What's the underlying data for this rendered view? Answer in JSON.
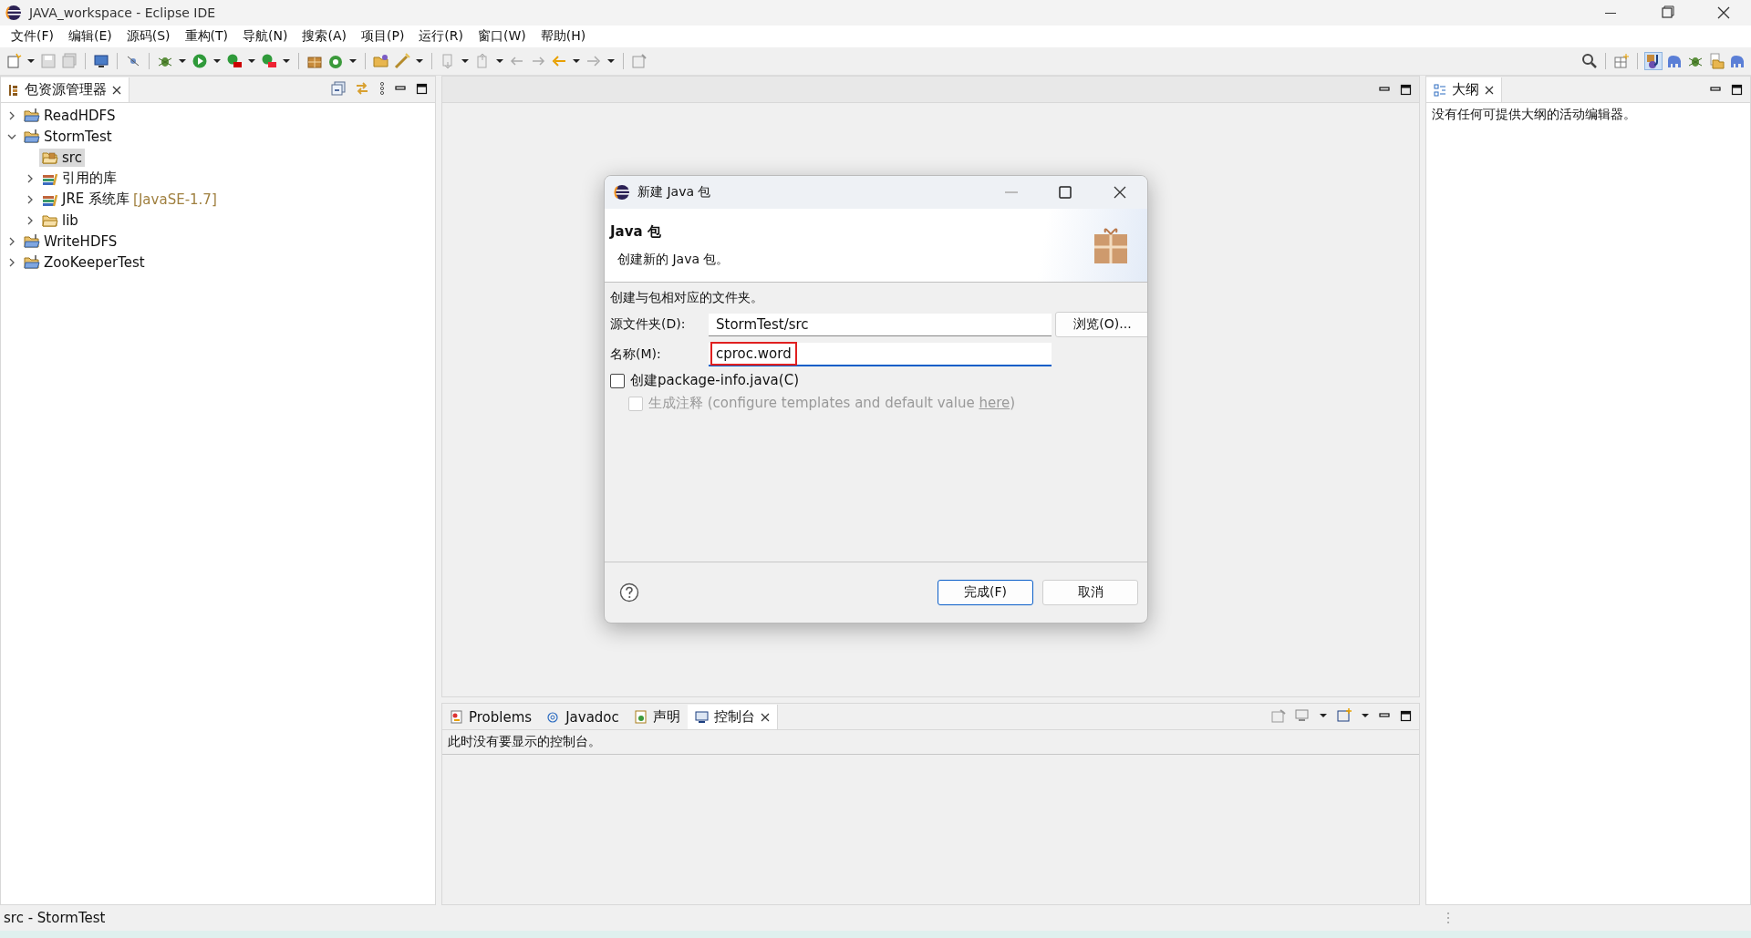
{
  "window": {
    "title": "JAVA_workspace - Eclipse IDE"
  },
  "menu": [
    "文件(F)",
    "编辑(E)",
    "源码(S)",
    "重构(T)",
    "导航(N)",
    "搜索(A)",
    "项目(P)",
    "运行(R)",
    "窗口(W)",
    "帮助(H)"
  ],
  "package_explorer": {
    "tab": "包资源管理器",
    "tree": [
      {
        "label": "ReadHDFS",
        "kind": "project",
        "expanded": false,
        "selected": false
      },
      {
        "label": "StormTest",
        "kind": "project",
        "expanded": true,
        "selected": false,
        "children": [
          {
            "label": "src",
            "kind": "source",
            "selected": true
          },
          {
            "label": "引用的库",
            "kind": "library",
            "expanded": false,
            "selected": false
          },
          {
            "label": "JRE 系统库",
            "decoration": "[JavaSE-1.7]",
            "kind": "library",
            "expanded": false,
            "selected": false
          },
          {
            "label": "lib",
            "kind": "folder",
            "expanded": false,
            "selected": false
          }
        ]
      },
      {
        "label": "WriteHDFS",
        "kind": "project",
        "expanded": false,
        "selected": false
      },
      {
        "label": "ZooKeeperTest",
        "kind": "project",
        "expanded": false,
        "selected": false
      }
    ]
  },
  "outline": {
    "tab": "大纲",
    "message": "没有任何可提供大纲的活动编辑器。"
  },
  "dialog": {
    "title": "新建 Java 包",
    "header": "Java 包",
    "description": "创建新的 Java 包。",
    "section": "创建与包相对应的文件夹。",
    "fields": [
      {
        "label": "源文件夹(D):",
        "value": "StormTest/src",
        "button": "浏览(O)...",
        "focused": false,
        "highlighted": false
      },
      {
        "label": "名称(M):",
        "value": "cproc.word",
        "focused": true,
        "highlighted": true
      }
    ],
    "checkboxes": [
      {
        "label": "创建package-info.java(C)",
        "checked": false,
        "disabled": false
      },
      {
        "label": "生成注释 (configure templates and default value ",
        "link": "here",
        "suffix": ")",
        "checked": false,
        "disabled": true
      }
    ],
    "buttons": [
      {
        "label": "完成(F)",
        "default": true
      },
      {
        "label": "取消",
        "default": false
      }
    ]
  },
  "bottom_panel": {
    "tabs": [
      {
        "label": "Problems",
        "kind": "problems",
        "selected": false
      },
      {
        "label": "Javadoc",
        "kind": "javadoc",
        "selected": false
      },
      {
        "label": "声明",
        "kind": "declaration",
        "selected": false
      },
      {
        "label": "控制台",
        "kind": "console",
        "selected": true
      }
    ],
    "message": "此时没有要显示的控制台。"
  },
  "status_bar": "src - StormTest"
}
